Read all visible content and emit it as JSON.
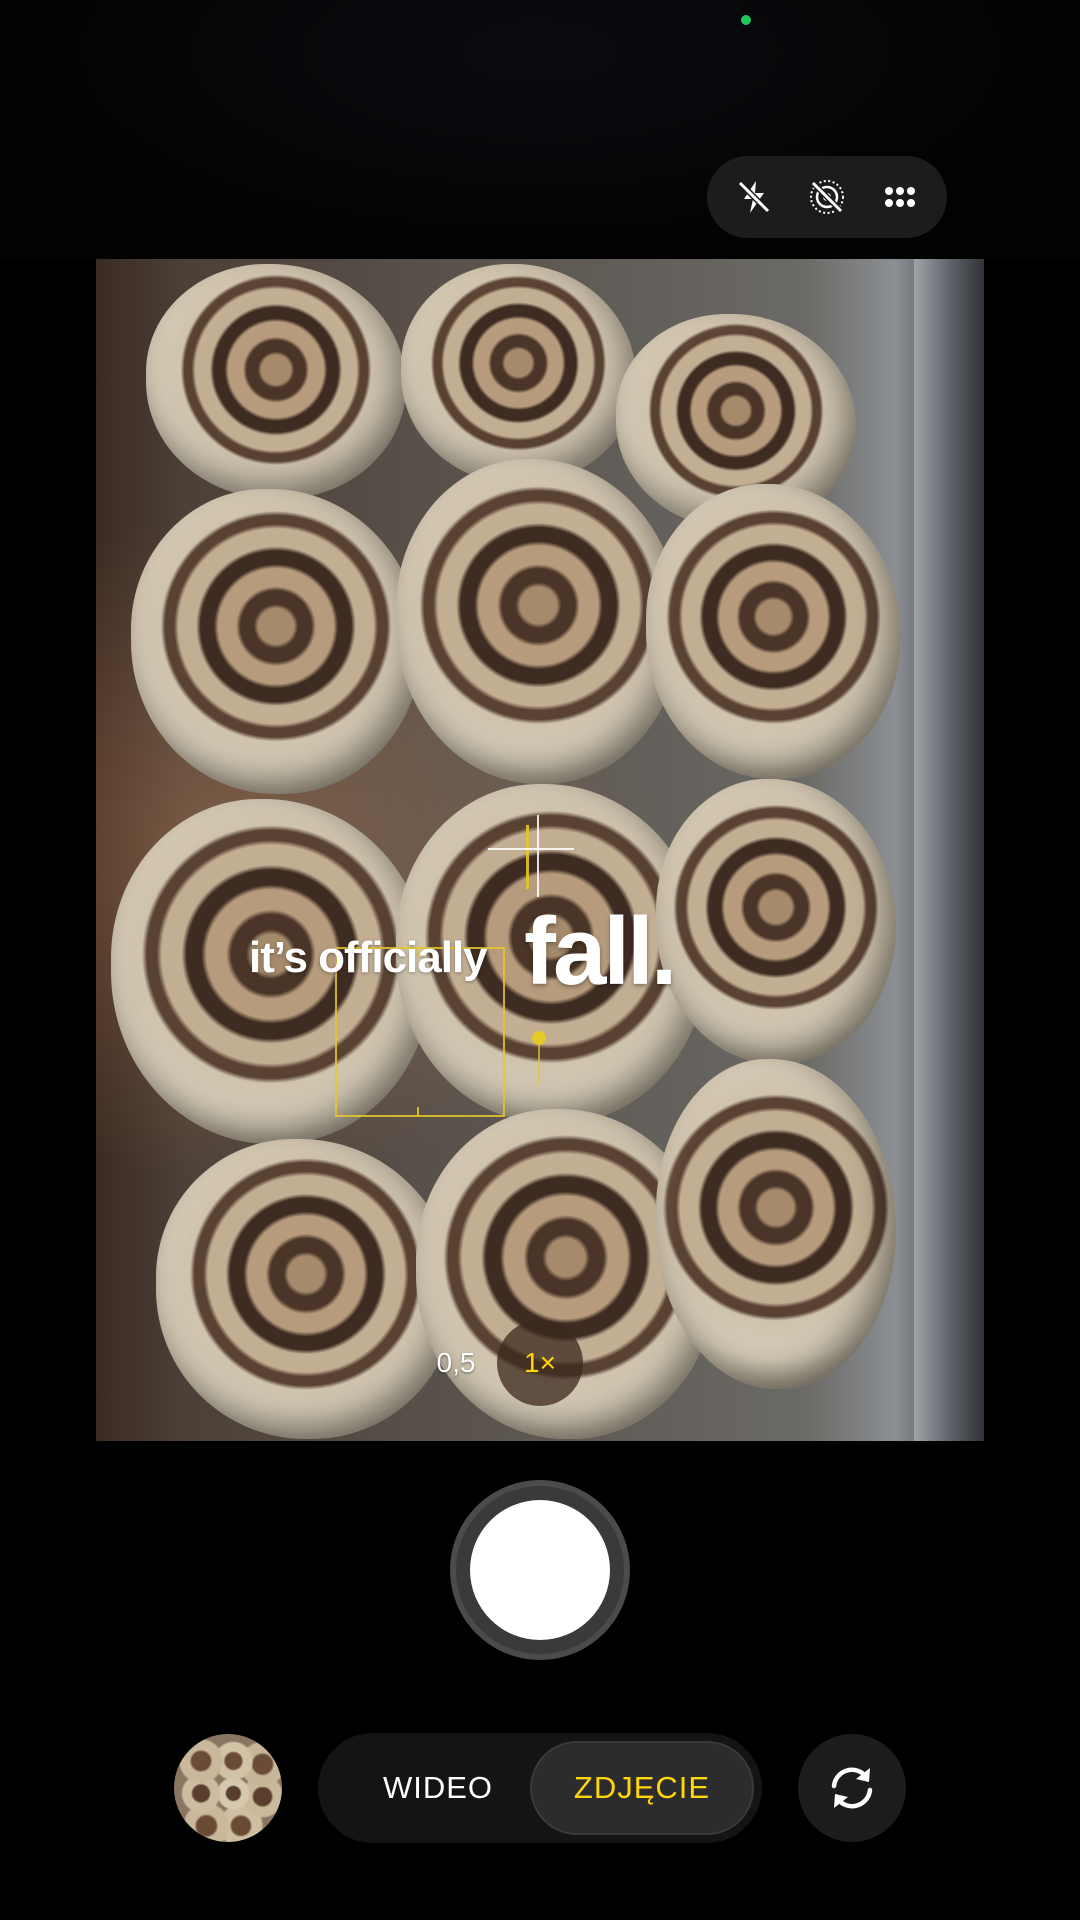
{
  "top_controls": {
    "items": [
      {
        "icon": "flash-off-icon"
      },
      {
        "icon": "live-photo-off-icon"
      },
      {
        "icon": "more-options-icon"
      }
    ]
  },
  "viewfinder": {
    "overlay_text_small": "it’s officially",
    "overlay_text_big": "fall."
  },
  "zoom": {
    "options": [
      "0,5",
      "1×"
    ],
    "selected": "1×"
  },
  "modes": {
    "video_label": "WIDEO",
    "photo_label": "ZDJĘCIE",
    "selected": "ZDJĘCIE"
  },
  "colors": {
    "accent": "#ffd60a",
    "camera_indicator": "#22c55e"
  }
}
